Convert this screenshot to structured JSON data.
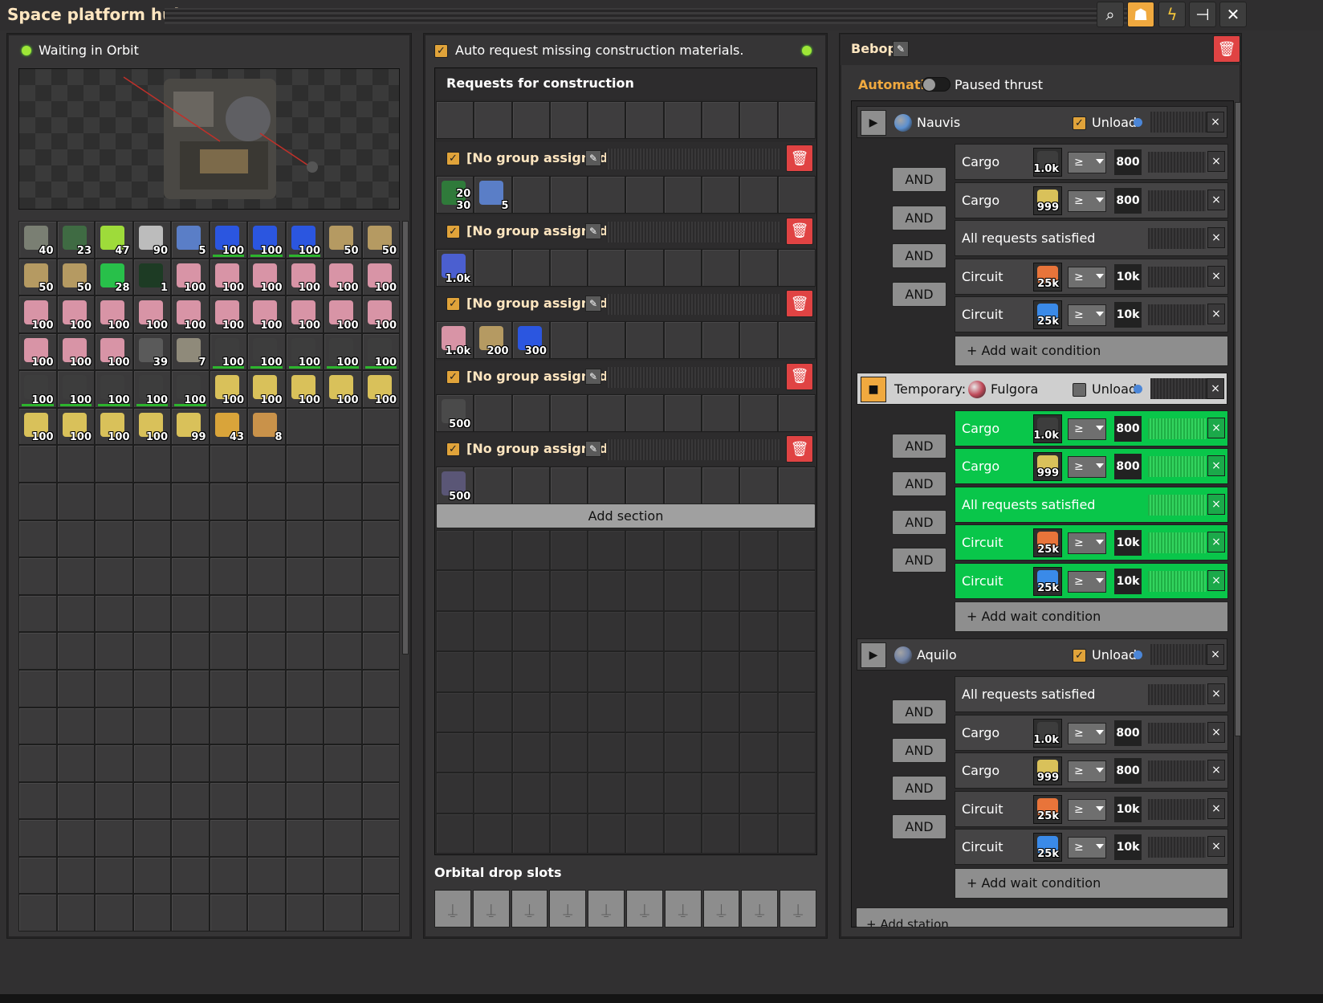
{
  "title": "Space platform hub",
  "status": "Waiting in Orbit",
  "auto_request": "Auto request missing construction materials.",
  "requests_header": "Requests for construction",
  "group_label": "[No group assigned]",
  "add_section": "Add section",
  "orbital_drop": "Orbital drop slots",
  "platform_name": "Bebop",
  "mode": "Automatic",
  "paused": "Paused thrust",
  "colors": {
    "accent": "#f0a93f",
    "green": "#09c64a",
    "red": "#e04343"
  },
  "inventory": [
    {
      "c": "40",
      "k": "#7a7f73"
    },
    {
      "c": "23",
      "k": "#3f6b43"
    },
    {
      "c": "47",
      "k": "#9edb3a"
    },
    {
      "c": "90",
      "k": "#bcbcbc"
    },
    {
      "c": "5",
      "k": "#5a7ec7"
    },
    {
      "c": "100",
      "k": "#2b56e0",
      "b": 1
    },
    {
      "c": "100",
      "k": "#2b56e0",
      "b": 1
    },
    {
      "c": "100",
      "k": "#2b56e0",
      "b": 1
    },
    {
      "c": "50",
      "k": "#b59a62"
    },
    {
      "c": "50",
      "k": "#b59a62"
    },
    {
      "c": "50",
      "k": "#b59a62"
    },
    {
      "c": "50",
      "k": "#b59a62"
    },
    {
      "c": "28",
      "k": "#28c04a"
    },
    {
      "c": "1",
      "k": "#1d3b24"
    },
    {
      "c": "100",
      "k": "#d894a6"
    },
    {
      "c": "100",
      "k": "#d894a6"
    },
    {
      "c": "100",
      "k": "#d894a6"
    },
    {
      "c": "100",
      "k": "#d894a6"
    },
    {
      "c": "100",
      "k": "#d894a6"
    },
    {
      "c": "100",
      "k": "#d894a6"
    },
    {
      "c": "100",
      "k": "#d894a6"
    },
    {
      "c": "100",
      "k": "#d894a6"
    },
    {
      "c": "100",
      "k": "#d894a6"
    },
    {
      "c": "100",
      "k": "#d894a6"
    },
    {
      "c": "100",
      "k": "#d894a6"
    },
    {
      "c": "100",
      "k": "#d894a6"
    },
    {
      "c": "100",
      "k": "#d894a6"
    },
    {
      "c": "100",
      "k": "#d894a6"
    },
    {
      "c": "100",
      "k": "#d894a6"
    },
    {
      "c": "100",
      "k": "#d894a6"
    },
    {
      "c": "100",
      "k": "#d894a6"
    },
    {
      "c": "100",
      "k": "#d894a6"
    },
    {
      "c": "100",
      "k": "#d894a6"
    },
    {
      "c": "39",
      "k": "#5a5a5a"
    },
    {
      "c": "7",
      "k": "#8f8a7a"
    },
    {
      "c": "100",
      "k": "#3d3d3d",
      "b": 1
    },
    {
      "c": "100",
      "k": "#3d3d3d",
      "b": 1
    },
    {
      "c": "100",
      "k": "#3d3d3d",
      "b": 1
    },
    {
      "c": "100",
      "k": "#3d3d3d",
      "b": 1
    },
    {
      "c": "100",
      "k": "#3d3d3d",
      "b": 1
    },
    {
      "c": "100",
      "k": "#3d3d3d",
      "b": 1
    },
    {
      "c": "100",
      "k": "#3d3d3d",
      "b": 1
    },
    {
      "c": "100",
      "k": "#3d3d3d",
      "b": 1
    },
    {
      "c": "100",
      "k": "#3d3d3d",
      "b": 1
    },
    {
      "c": "100",
      "k": "#3d3d3d",
      "b": 1
    },
    {
      "c": "100",
      "k": "#d9c15a"
    },
    {
      "c": "100",
      "k": "#d9c15a"
    },
    {
      "c": "100",
      "k": "#d9c15a"
    },
    {
      "c": "100",
      "k": "#d9c15a"
    },
    {
      "c": "100",
      "k": "#d9c15a"
    },
    {
      "c": "100",
      "k": "#d9c15a"
    },
    {
      "c": "100",
      "k": "#d9c15a"
    },
    {
      "c": "100",
      "k": "#d9c15a"
    },
    {
      "c": "100",
      "k": "#d9c15a"
    },
    {
      "c": "99",
      "k": "#d9c15a"
    },
    {
      "c": "43",
      "k": "#d9a43a"
    },
    {
      "c": "8",
      "k": "#c9924a"
    }
  ],
  "sections": [
    {
      "items": [
        {
          "c": "30",
          "c2": "20",
          "k": "#2f7a3a"
        },
        {
          "c": "5",
          "k": "#5a7ec7"
        }
      ]
    },
    {
      "items": [
        {
          "c": "1.0k",
          "k": "#4b5fd0"
        }
      ]
    },
    {
      "items": [
        {
          "c": "1.0k",
          "k": "#d894a6"
        },
        {
          "c": "200",
          "k": "#b59a62"
        },
        {
          "c": "300",
          "k": "#2b56e0"
        }
      ]
    },
    {
      "items": [
        {
          "c": "500",
          "k": "#4a4a4a"
        }
      ]
    },
    {
      "items": [
        {
          "c": "500",
          "k": "#5a5676"
        }
      ]
    }
  ],
  "stations": [
    {
      "name": "Nauvis",
      "prefix": "",
      "unload": "Unload",
      "checked": true,
      "planet": "#5b8fd0",
      "temp": false,
      "conds": [
        {
          "t": "Cargo",
          "ic": "#3d3d3d",
          "n": "1.0k",
          "cmp": "≥",
          "v": "800"
        },
        {
          "t": "Cargo",
          "ic": "#d9c15a",
          "n": "999",
          "cmp": "≥",
          "v": "800"
        },
        {
          "t": "All requests satisfied"
        },
        {
          "t": "Circuit",
          "ic": "#e8743a",
          "n": "25k",
          "cmp": "≥",
          "v": "10k"
        },
        {
          "t": "Circuit",
          "ic": "#3a8ae8",
          "n": "25k",
          "cmp": "≥",
          "v": "10k"
        }
      ]
    },
    {
      "name": "Fulgora",
      "prefix": "Temporary:",
      "unload": "Unload",
      "checked": false,
      "planet": "#c04a5a",
      "temp": true,
      "conds": [
        {
          "t": "Cargo",
          "ic": "#3d3d3d",
          "n": "1.0k",
          "cmp": "≥",
          "v": "800"
        },
        {
          "t": "Cargo",
          "ic": "#d9c15a",
          "n": "999",
          "cmp": "≥",
          "v": "800"
        },
        {
          "t": "All requests satisfied"
        },
        {
          "t": "Circuit",
          "ic": "#e8743a",
          "n": "25k",
          "cmp": "≥",
          "v": "10k"
        },
        {
          "t": "Circuit",
          "ic": "#3a8ae8",
          "n": "25k",
          "cmp": "≥",
          "v": "10k"
        }
      ]
    },
    {
      "name": "Aquilo",
      "prefix": "",
      "unload": "Unload",
      "checked": true,
      "planet": "#6d7fa3",
      "temp": false,
      "conds": [
        {
          "t": "All requests satisfied"
        },
        {
          "t": "Cargo",
          "ic": "#3d3d3d",
          "n": "1.0k",
          "cmp": "≥",
          "v": "800"
        },
        {
          "t": "Cargo",
          "ic": "#d9c15a",
          "n": "999",
          "cmp": "≥",
          "v": "800"
        },
        {
          "t": "Circuit",
          "ic": "#e8743a",
          "n": "25k",
          "cmp": "≥",
          "v": "10k"
        },
        {
          "t": "Circuit",
          "ic": "#3a8ae8",
          "n": "25k",
          "cmp": "≥",
          "v": "10k"
        }
      ]
    }
  ],
  "and_label": "AND",
  "add_wait": "+ Add wait condition",
  "add_station": "+ Add station",
  "close_x": "×"
}
